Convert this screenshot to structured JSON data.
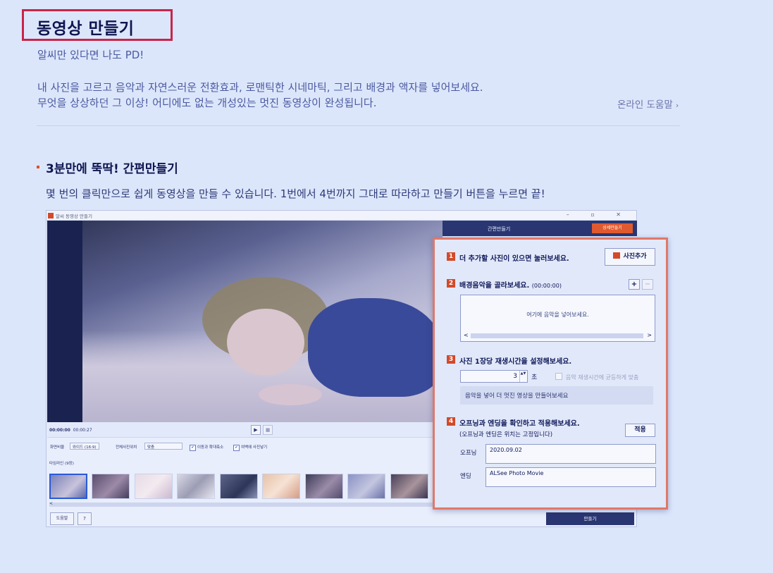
{
  "header": {
    "title": "동영상 만들기",
    "tagline": "알씨만 있다면 나도 PD!",
    "desc_line1": "내 사진을 고르고 음악과 자연스러운 전환효과, 로맨틱한 시네마틱, 그리고 배경과 액자를 넣어보세요.",
    "desc_line2": "무엇을 상상하던 그 이상! 어디에도 없는 개성있는 멋진 동영상이 완성됩니다.",
    "help_link": "온라인 도움말",
    "help_chevron": "›"
  },
  "section": {
    "title": "3분만에 뚝딱! 간편만들기",
    "description": "몇 번의 클릭만으로 쉽게 동영상을 만들 수 있습니다. 1번에서 4번까지 그대로 따라하고 만들기 버튼을 누르면 끝!"
  },
  "app": {
    "window_title": "알씨 동영상 만들기",
    "window_controls": "–  ▫  ✕",
    "side_panel_title": "간편만들기",
    "detail_button": "상세만들기",
    "time_current": "00:00:00",
    "time_total": "00:00:27",
    "play": "▶",
    "stop": "■",
    "ratio_label": "화면비율",
    "ratio_value": "와이드 (16:9)",
    "position_label": "전체사진위치",
    "position_value": "맞춤",
    "option_move": "이동과 확대축소",
    "option_blank": "여백에 사진넣기",
    "timeline_label": "타임라인 (9장)",
    "help_button": "도움말",
    "question_button": "?",
    "make_button": "만들기"
  },
  "panel": {
    "step1": {
      "num": "1",
      "text": "더 추가할 사진이 있으면 눌러보세요.",
      "button": "사진추가"
    },
    "step2": {
      "num": "2",
      "text": "배경음악을 골라보세요.",
      "duration": "(00:00:00)",
      "plus": "+",
      "minus": "−",
      "placeholder": "여기에 음악을 넣어보세요.",
      "scroll_left": "<",
      "scroll_right": ">"
    },
    "step3": {
      "num": "3",
      "text": "사진 1장당 재생시간을 설정해보세요.",
      "value": "3",
      "spin": "▲▼",
      "unit": "초",
      "equal_label": "음악 재생시간에 균등하게 맞춤",
      "hint": "음악을 넣어 더 멋진 영상을 만들어보세요"
    },
    "step4": {
      "num": "4",
      "text": "오프닝과 엔딩을 확인하고 적용해보세요.",
      "subtext": "(오프닝과 엔딩은 위치는 고정입니다)",
      "apply": "적용",
      "opening_label": "오프닝",
      "opening_value": "2020.09.02",
      "ending_label": "엔딩",
      "ending_value": "ALSee Photo Movie"
    }
  },
  "colors": {
    "accent_red": "#c8254a",
    "step_red": "#d24a2a",
    "panel_border": "#e07868",
    "navy": "#2a3672"
  }
}
